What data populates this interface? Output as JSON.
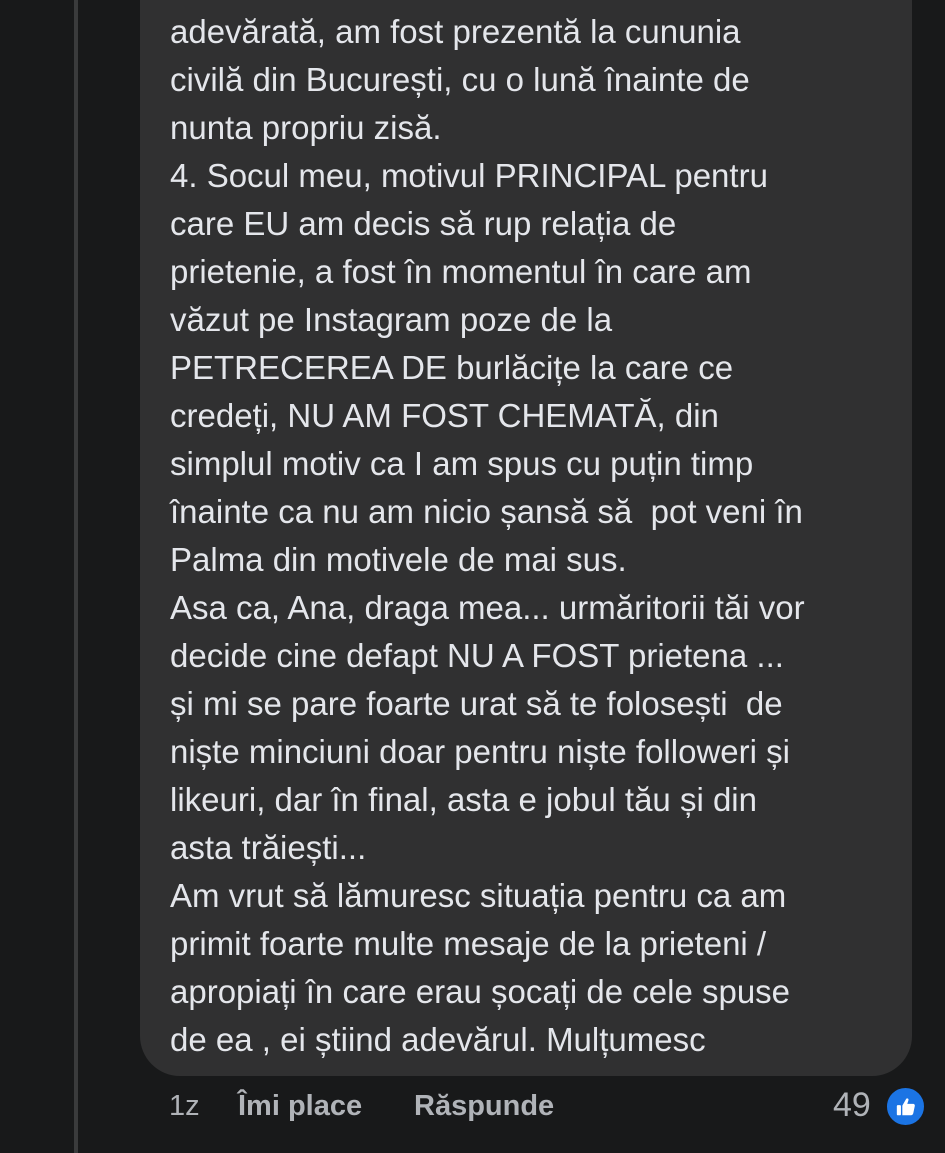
{
  "comment": {
    "lines": [
      "adevărată, am fost prezentă la cununia",
      "civilă din București, cu o lună înainte de",
      "nunta propriu zisă.",
      "4. Socul meu, motivul PRINCIPAL pentru",
      "care EU am decis să rup relația de",
      "prietenie, a fost în momentul în care am",
      "văzut pe Instagram poze de la",
      "PETRECEREA DE burlăcițe la care ce",
      "credeți, NU AM FOST CHEMATĂ, din",
      "simplul motiv ca I am spus cu puțin timp",
      "înainte ca nu am nicio șansă să  pot veni în",
      "Palma din motivele de mai sus.",
      "Asa ca, Ana, draga mea... urmăritorii tăi vor",
      "decide cine defapt NU A FOST prietena ...",
      "și mi se pare foarte urat să te folosești  de",
      "niște minciuni doar pentru niște followeri și",
      "likeuri, dar în final, asta e jobul tău și din",
      "asta trăiești...",
      "Am vrut să lămuresc situația pentru ca am",
      "primit foarte multe mesaje de la prieteni /",
      "apropiați în care erau șocați de cele spuse",
      "de ea , ei știind adevărul. Mulțumesc"
    ]
  },
  "actions": {
    "time": "1z",
    "like_label": "Îmi place",
    "reply_label": "Răspunde",
    "reaction_count": "49",
    "reaction_icon": "like-thumbs-up-icon"
  },
  "colors": {
    "background": "#18191a",
    "bubble": "#303031",
    "text": "#e4e6eb",
    "secondary_text": "#b0b3b8",
    "like_blue": "#1b74e4"
  }
}
